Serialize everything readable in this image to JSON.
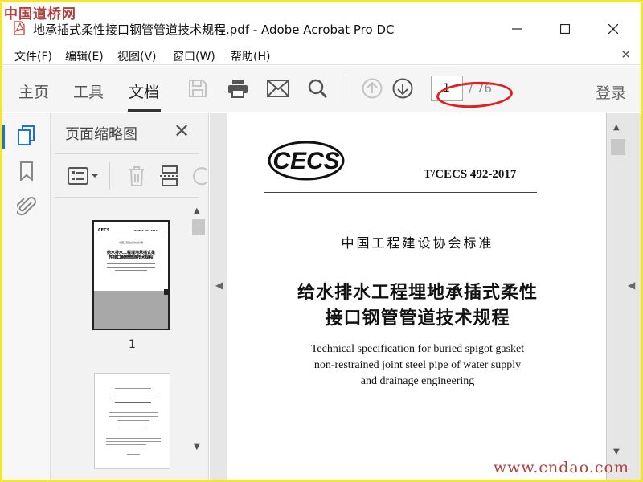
{
  "watermark": {
    "top": "中国道桥网",
    "bottom": "www.cndao.com"
  },
  "window": {
    "title": "地承插式柔性接口钢管管道技术规程.pdf - Adobe Acrobat Pro DC"
  },
  "menu": {
    "items": [
      "文件(F)",
      "编辑(E)",
      "视图(V)",
      "窗口(W)",
      "帮助(H)"
    ]
  },
  "toolbar": {
    "tabs": [
      "主页",
      "工具",
      "文档"
    ],
    "page_current": "1",
    "page_total": "/ 76",
    "login": "登录"
  },
  "thumbnails": {
    "title": "页面缩略图",
    "page1_label": "1",
    "thumb1": {
      "std_no": "T/CECS 492-2017",
      "assoc": "中国工程建设协会标准",
      "title": "给水排水工程埋地承插式柔性接口钢管管道技术规程"
    }
  },
  "document": {
    "logo": "CECS",
    "standard_no": "T/CECS 492-2017",
    "association": "中国工程建设协会标准",
    "title_cn_line1": "给水排水工程埋地承插式柔性",
    "title_cn_line2": "接口钢管管道技术规程",
    "title_en_line1": "Technical specification for buried spigot gasket",
    "title_en_line2": "non-restrained joint steel pipe of water supply",
    "title_en_line3": "and drainage engineering"
  },
  "colors": {
    "accent": "#1a73d8",
    "highlight_ellipse": "#e02020",
    "border": "#f2e53a"
  }
}
